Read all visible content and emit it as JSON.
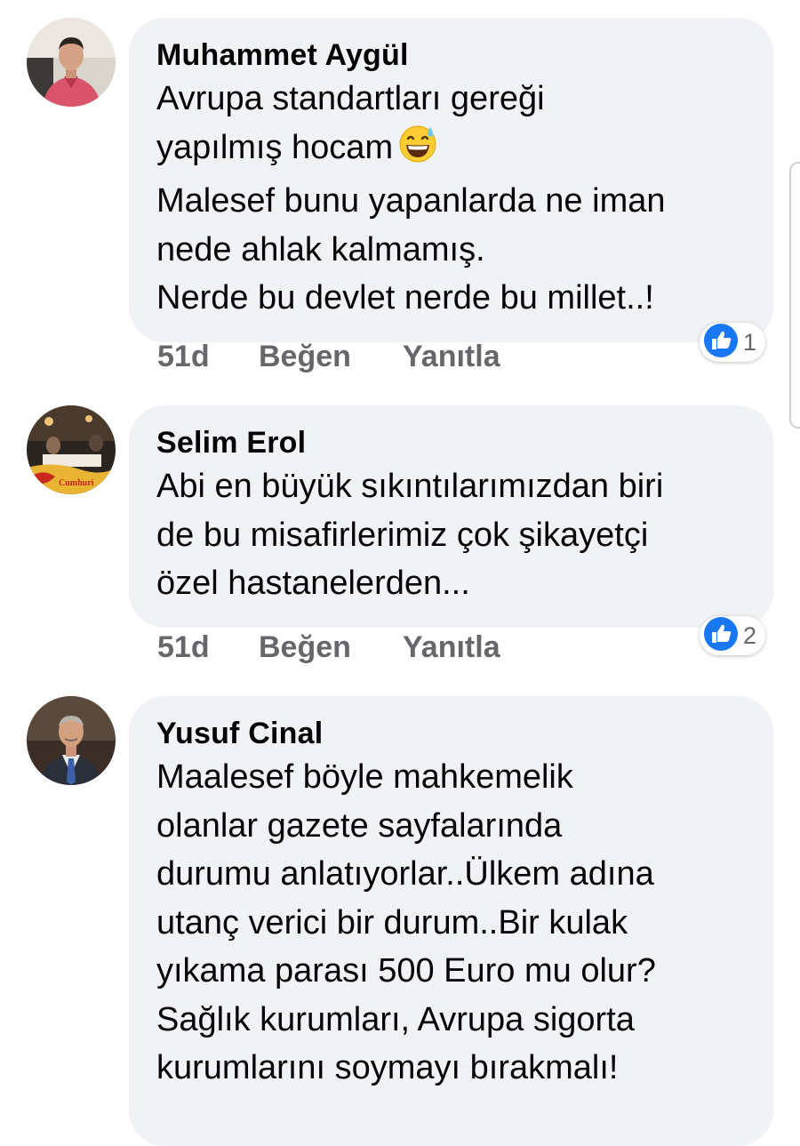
{
  "comments": [
    {
      "author": "Muhammet Aygül",
      "lines": [
        "Avrupa standartları gereği",
        "yapılmış hocam",
        "Malesef bunu yapanlarda ne iman",
        "nede ahlak kalmamış.",
        "Nerde bu devlet nerde bu millet..!"
      ],
      "emoji": "grinning-sweat-emoji",
      "time": "51d",
      "like_label": "Beğen",
      "reply_label": "Yanıtla",
      "reaction_icon": "like-icon",
      "reaction_count": "1"
    },
    {
      "author": "Selim Erol",
      "lines": [
        "Abi en büyük sıkıntılarımızdan biri",
        "de bu misafirlerimiz çok şikayetçi",
        "özel hastanelerden..."
      ],
      "time": "51d",
      "like_label": "Beğen",
      "reply_label": "Yanıtla",
      "reaction_icon": "like-icon",
      "reaction_count": "2"
    },
    {
      "author": "Yusuf Cinal",
      "lines": [
        "Maalesef böyle mahkemelik",
        "olanlar gazete sayfalarında",
        "durumu anlatıyorlar..Ülkem adına",
        "utanç verici bir durum..Bir kulak",
        "yıkama parası 500 Euro mu olur?",
        "Sağlık kurumları, Avrupa sigorta",
        "kurumlarını soymayı bırakmalı!"
      ]
    }
  ],
  "colors": {
    "bubble": "#f0f2f5",
    "text": "#050505",
    "meta": "#65676b",
    "like_blue": "#1877f2"
  }
}
